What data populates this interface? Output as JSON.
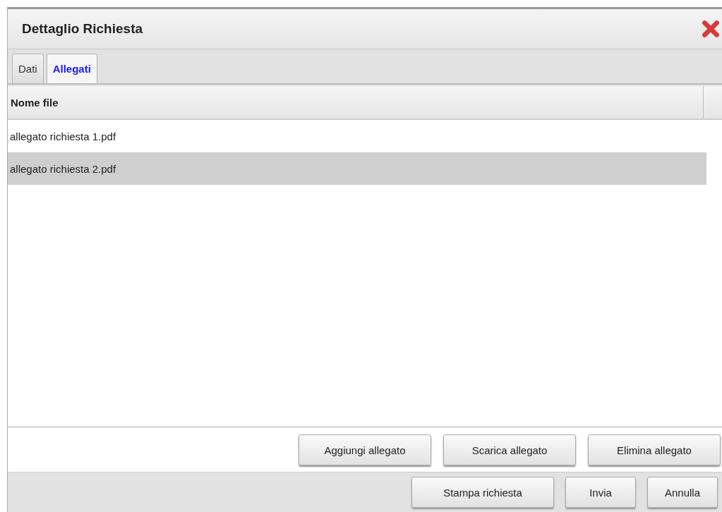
{
  "window": {
    "title": "Dettaglio Richiesta"
  },
  "tabs": [
    {
      "label": "Dati",
      "selected": false
    },
    {
      "label": "Allegati",
      "selected": true
    }
  ],
  "table": {
    "columns": [
      "Nome file"
    ],
    "rows": [
      {
        "name": "allegato richiesta 1.pdf",
        "selected": false
      },
      {
        "name": "allegato richiesta 2.pdf",
        "selected": true
      }
    ]
  },
  "attachment_buttons": [
    "Aggiungi allegato",
    "Scarica allegato",
    "Elimina allegato"
  ],
  "footer_buttons": [
    "Stampa richiesta",
    "Invia",
    "Annulla"
  ]
}
